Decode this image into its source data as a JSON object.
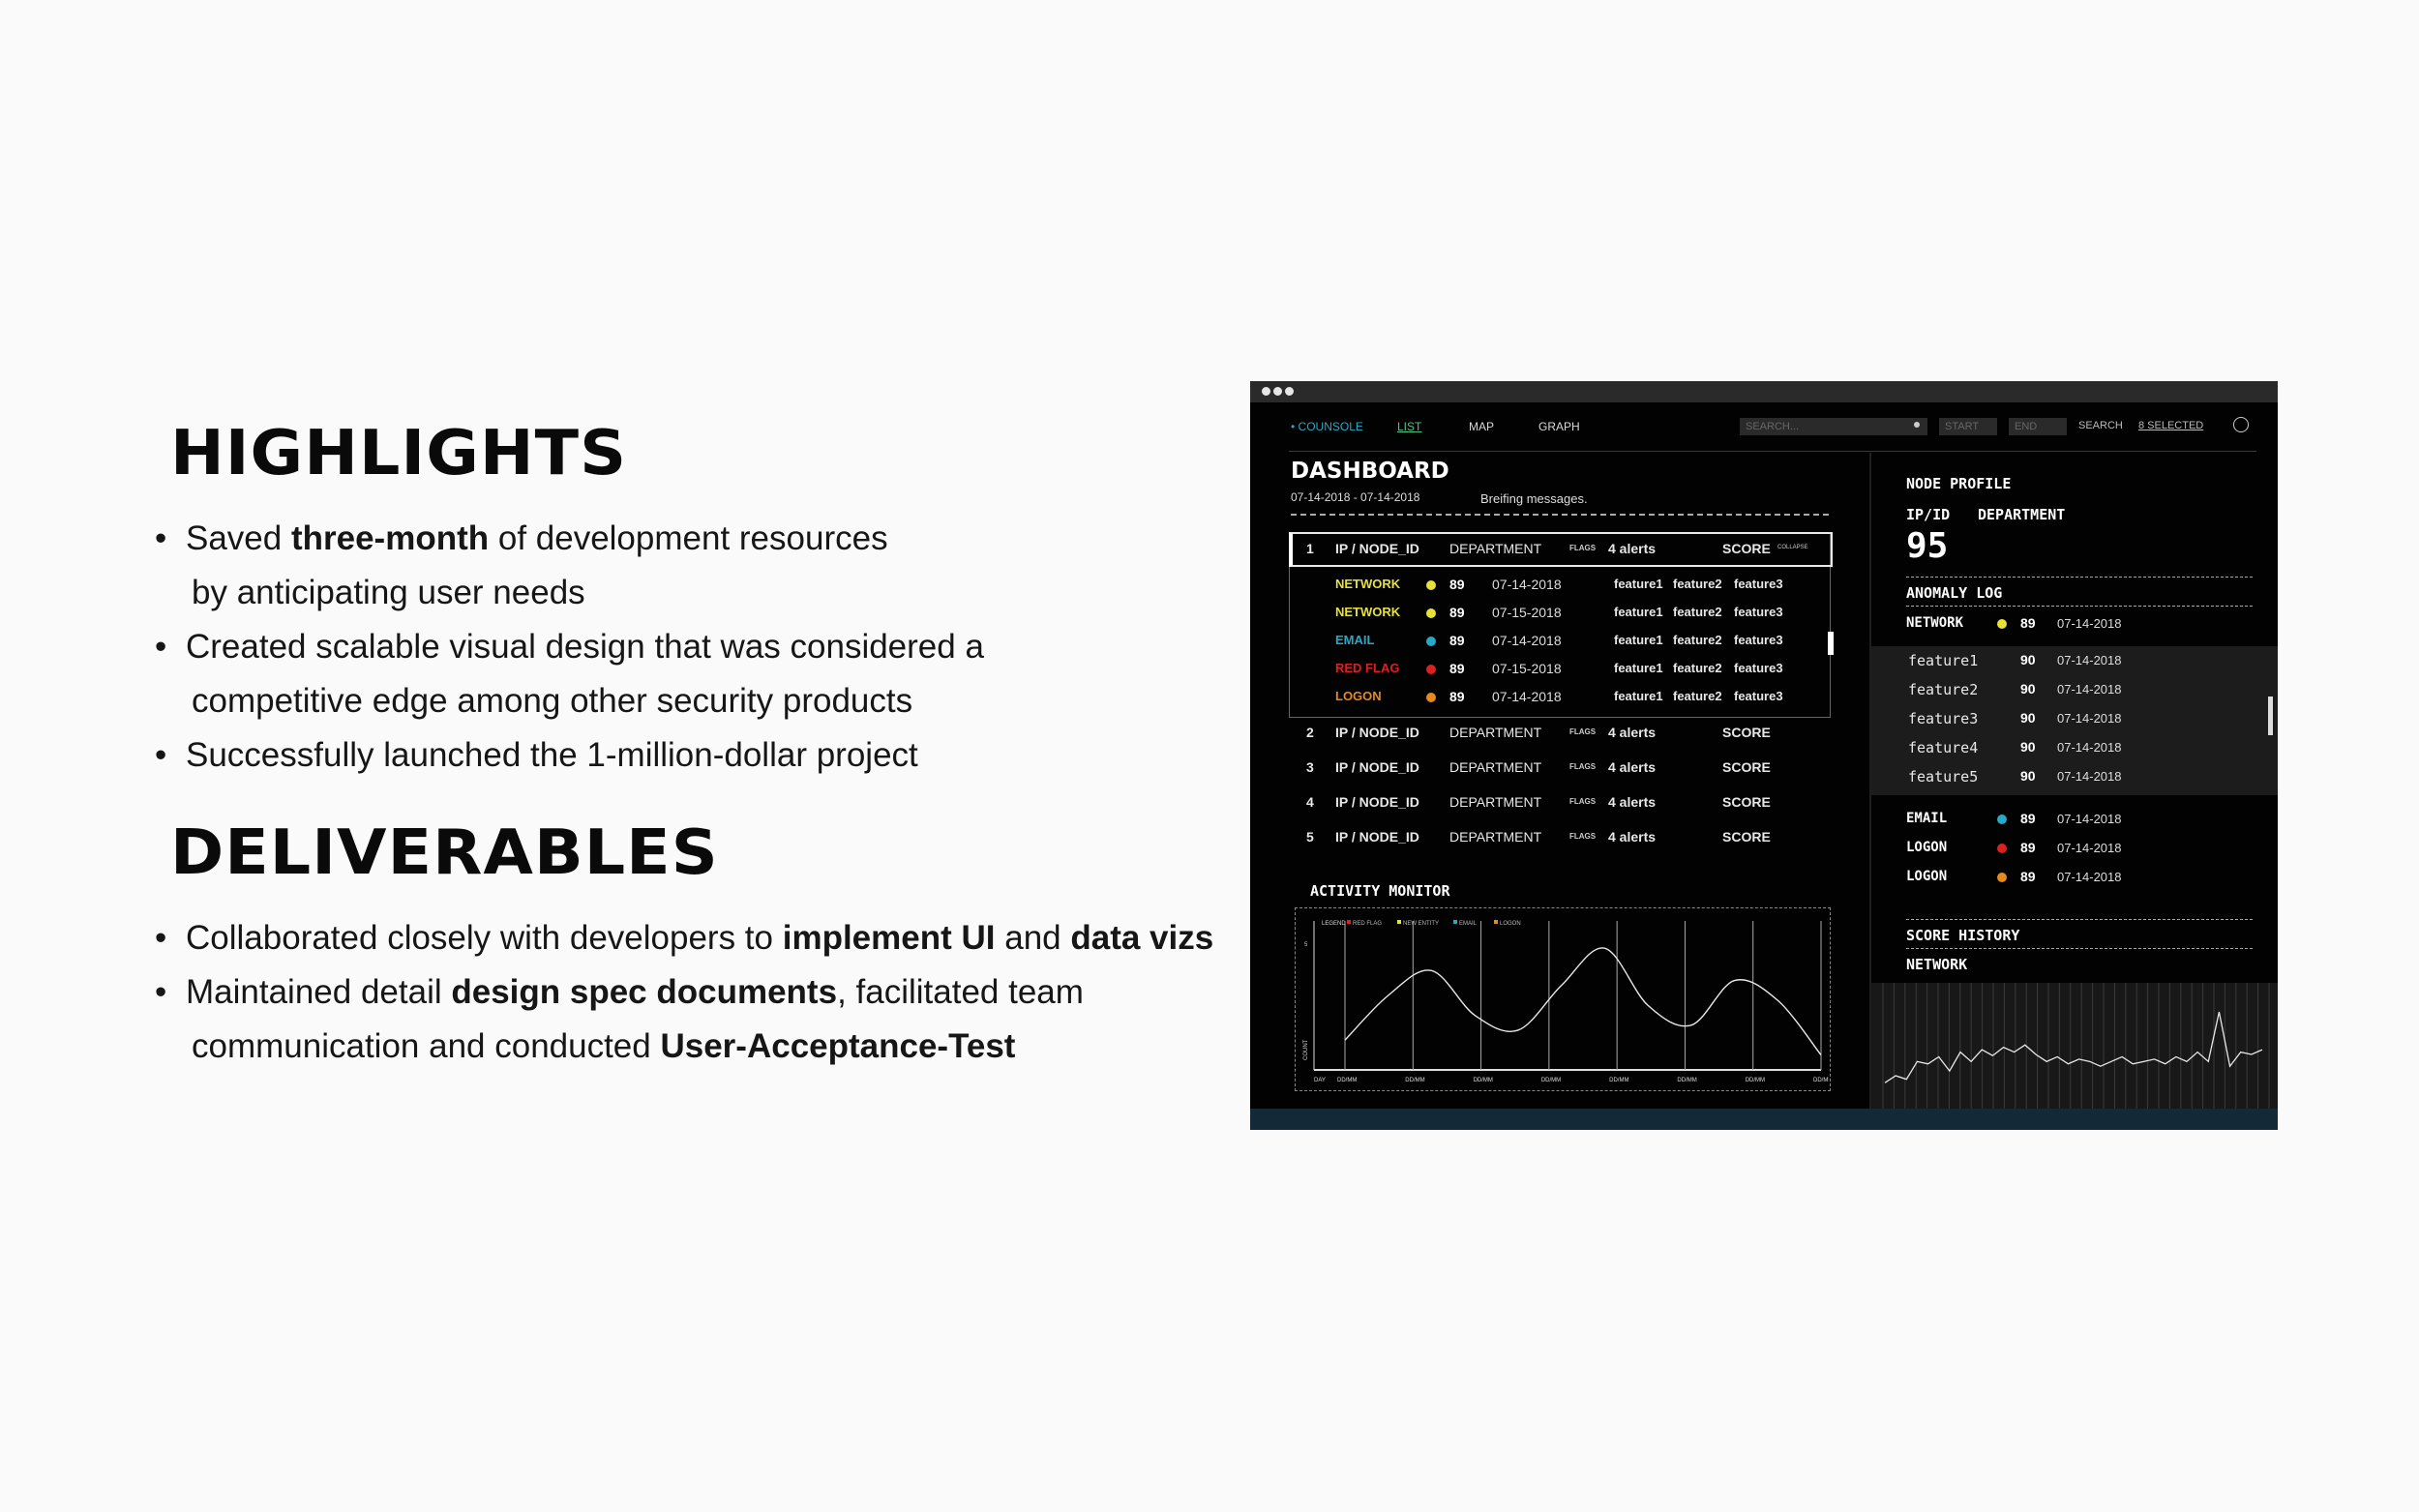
{
  "highlights": {
    "title": "HIGHLIGHTS",
    "items": [
      {
        "parts": [
          {
            "t": "Saved "
          },
          {
            "t": "three-month",
            "b": true
          },
          {
            "t": " of development resources"
          }
        ],
        "line2": "by anticipating user needs"
      },
      {
        "parts": [
          {
            "t": "Created scalable visual design that was considered a"
          }
        ],
        "line2": "competitive edge among other security products"
      },
      {
        "parts": [
          {
            "t": "Successfully launched the 1-million-dollar project"
          }
        ],
        "line2": ""
      }
    ]
  },
  "deliverables": {
    "title": "DELIVERABLES",
    "items": [
      {
        "parts": [
          {
            "t": "Collaborated closely with developers to "
          },
          {
            "t": "implement UI",
            "b": true
          },
          {
            "t": " and "
          },
          {
            "t": "data vizs",
            "b": true
          }
        ],
        "line2": ""
      },
      {
        "parts": [
          {
            "t": "Maintained detail "
          },
          {
            "t": "design spec documents",
            "b": true
          },
          {
            "t": ", facilitated team"
          }
        ],
        "line2_parts": [
          {
            "t": "communication and conducted "
          },
          {
            "t": "User-Acceptance-Test",
            "b": true
          }
        ]
      }
    ]
  },
  "app": {
    "nav": {
      "console": "COUNSOLE",
      "list": "LIST",
      "map": "MAP",
      "graph": "GRAPH"
    },
    "search": {
      "placeholder": "SEARCH...",
      "start": "START",
      "end": "END",
      "button": "SEARCH",
      "selected": "8 SELECTED"
    },
    "dashboard": {
      "title": "DASHBOARD",
      "date_range": "07-14-2018 - 07-14-2018",
      "briefing": "Breifing messages."
    },
    "table_header": {
      "ip": "IP / NODE_ID",
      "department": "DEPARTMENT",
      "flags": "FLAGS",
      "alerts": "4 alerts",
      "score": "SCORE",
      "collapse": "COLLAPSE"
    },
    "rows": [
      {
        "num": "1"
      },
      {
        "num": "2"
      },
      {
        "num": "3"
      },
      {
        "num": "4"
      },
      {
        "num": "5"
      }
    ],
    "subrows": [
      {
        "type": "NETWORK",
        "color": "#e7e13a",
        "score": "89",
        "date": "07-14-2018",
        "f1": "feature1",
        "f2": "feature2",
        "f3": "feature3"
      },
      {
        "type": "NETWORK",
        "color": "#e7e13a",
        "score": "89",
        "date": "07-15-2018",
        "f1": "feature1",
        "f2": "feature2",
        "f3": "feature3"
      },
      {
        "type": "EMAIL",
        "color": "#27a9c4",
        "score": "89",
        "date": "07-14-2018",
        "f1": "feature1",
        "f2": "feature2",
        "f3": "feature3"
      },
      {
        "type": "RED FLAG",
        "color": "#d9211f",
        "score": "89",
        "date": "07-15-2018",
        "f1": "feature1",
        "f2": "feature2",
        "f3": "feature3"
      },
      {
        "type": "LOGON",
        "color": "#e58a1c",
        "score": "89",
        "date": "07-14-2018",
        "f1": "feature1",
        "f2": "feature2",
        "f3": "feature3"
      }
    ],
    "activity": {
      "title": "ACTIVITY MONITOR",
      "legend": {
        "label": "LEGEND",
        "items": [
          {
            "name": "RED FLAG",
            "color": "#d9211f"
          },
          {
            "name": "NEW ENTITY",
            "color": "#e7e13a"
          },
          {
            "name": "EMAIL",
            "color": "#27a9c4"
          },
          {
            "name": "LOGON",
            "color": "#e58a1c"
          }
        ]
      },
      "ylabel": "COUNT",
      "ytick": "5",
      "xticks": [
        "DAY",
        "DD/MM",
        "DD/MM",
        "DD/MM",
        "DD/MM",
        "DD/MM",
        "DD/MM",
        "DD/MM",
        "DD/MM"
      ]
    },
    "profile": {
      "title": "NODE PROFILE",
      "ip_label": "IP/ID",
      "dept_label": "DEPARTMENT",
      "score": "95",
      "anomaly_title": "ANOMALY LOG",
      "top": {
        "type": "NETWORK",
        "color": "#e7e13a",
        "score": "89",
        "date": "07-14-2018"
      },
      "features": [
        {
          "name": "feature1",
          "score": "90",
          "date": "07-14-2018"
        },
        {
          "name": "feature2",
          "score": "90",
          "date": "07-14-2018"
        },
        {
          "name": "feature3",
          "score": "90",
          "date": "07-14-2018"
        },
        {
          "name": "feature4",
          "score": "90",
          "date": "07-14-2018"
        },
        {
          "name": "feature5",
          "score": "90",
          "date": "07-14-2018"
        }
      ],
      "logs": [
        {
          "type": "EMAIL",
          "color": "#27a9c4",
          "score": "89",
          "date": "07-14-2018"
        },
        {
          "type": "LOGON",
          "color": "#d9211f",
          "score": "89",
          "date": "07-14-2018"
        },
        {
          "type": "LOGON",
          "color": "#e58a1c",
          "score": "89",
          "date": "07-14-2018"
        }
      ],
      "history_title": "SCORE HISTORY",
      "history_sub": "NETWORK"
    }
  },
  "chart_data": [
    {
      "type": "line",
      "title": "ACTIVITY MONITOR",
      "ylabel": "COUNT",
      "categories": [
        "DD/MM",
        "DD/MM",
        "DD/MM",
        "DD/MM",
        "DD/MM",
        "DD/MM",
        "DD/MM",
        "DD/MM"
      ],
      "values": [
        1.2,
        3.0,
        4.0,
        2.2,
        1.6,
        3.4,
        4.9,
        2.6,
        1.8,
        3.6,
        2.8,
        0.6
      ],
      "ylim": [
        0,
        6
      ]
    },
    {
      "type": "line",
      "title": "SCORE HISTORY",
      "values": [
        12,
        18,
        15,
        30,
        28,
        34,
        22,
        38,
        30,
        40,
        35,
        42,
        38,
        44,
        36,
        30,
        34,
        28,
        32,
        30,
        26,
        30,
        34,
        28,
        30,
        32,
        28,
        34,
        30,
        38,
        30,
        72,
        26,
        38,
        36,
        40
      ],
      "ylim": [
        0,
        90
      ]
    }
  ]
}
